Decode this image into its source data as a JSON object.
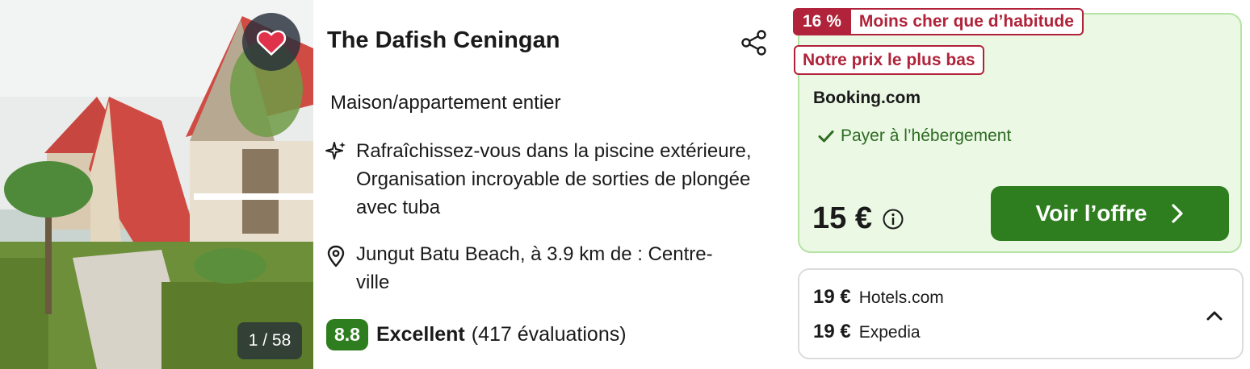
{
  "hotel": {
    "name": "The Dafish Ceningan",
    "type": "Maison/appartement entier",
    "amenities": "Rafraîchissez-vous dans la piscine extérieure, Organisation incroyable de sorties de plongée avec tuba",
    "location": "Jungut Batu Beach, à 3.9 km de : Centre-ville",
    "photo_counter": "1 / 58",
    "rating": {
      "score": "8.8",
      "label": "Excellent",
      "reviews": "(417 évaluations)"
    }
  },
  "offer": {
    "discount_pct": "16 %",
    "discount_text": "Moins cher que d’habitude",
    "lowest_badge": "Notre prix le plus bas",
    "provider": "Booking.com",
    "payment": "Payer à l’hébergement",
    "price": "15 €",
    "cta_label": "Voir l’offre"
  },
  "other_offers": [
    {
      "price": "19 €",
      "provider": "Hotels.com"
    },
    {
      "price": "19 €",
      "provider": "Expedia"
    }
  ],
  "colors": {
    "accent_green": "#2e7d1f",
    "deal_red": "#b0233a",
    "offer_bg": "#eaf8e4",
    "heart": "#e0324b"
  },
  "icons": [
    "heart-icon",
    "share-icon",
    "sparkle-icon",
    "map-pin-icon",
    "check-icon",
    "info-icon",
    "chevron-right-icon",
    "chevron-up-icon"
  ]
}
